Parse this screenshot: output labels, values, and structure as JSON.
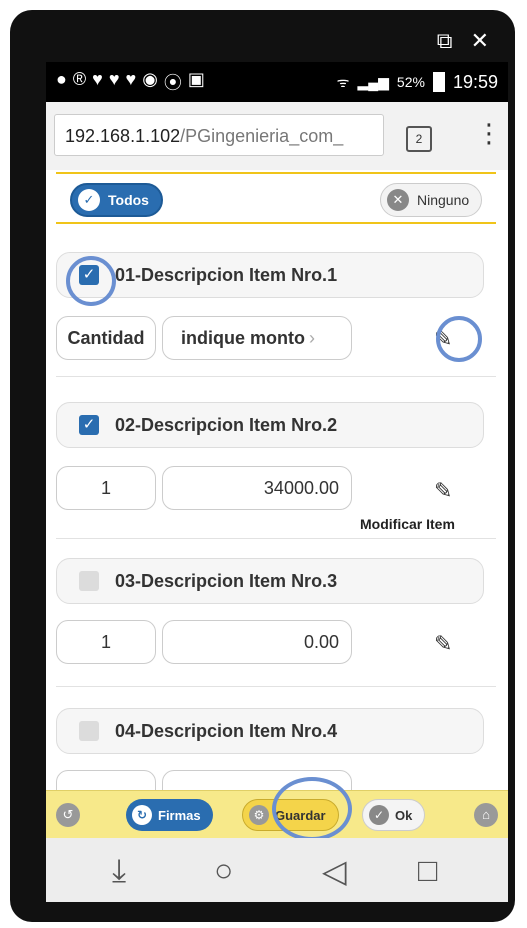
{
  "window_controls": {
    "expand_glyph": "⧉",
    "close_glyph": "✕"
  },
  "status_bar": {
    "notif_icons": [
      "●",
      "®",
      "♥",
      "♥",
      "♥",
      "◉",
      "⦿",
      "▣"
    ],
    "wifi": "ᯤ",
    "signal": "▂▄▆",
    "battery": "52%",
    "time": "19:59"
  },
  "browser": {
    "url_host": "192.168.1.102",
    "url_path": "/PGingenieria_com_",
    "tab_count": "2",
    "menu": "⋮"
  },
  "filters": {
    "all_label": "Todos",
    "none_label": "Ninguno",
    "all_icon": "✓",
    "none_icon": "✕"
  },
  "items": [
    {
      "title": "01-Descripcion Item Nro.1",
      "checked": true,
      "qty": "Cantidad",
      "value": "indique monto",
      "value_suffix": "›"
    },
    {
      "title": "02-Descripcion Item Nro.2",
      "checked": true,
      "qty": "1",
      "value": "34000.00",
      "edit_label": "Modificar Item"
    },
    {
      "title": "03-Descripcion Item Nro.3",
      "checked": false,
      "qty": "1",
      "value": "0.00"
    },
    {
      "title": "04-Descripcion Item Nro.4",
      "checked": false
    }
  ],
  "edit_icon": "✎",
  "footer": {
    "back": "↺",
    "firmas": "Firmas",
    "guardar": "Guardar",
    "ok": "Ok",
    "home": "⌂",
    "firmas_icon": "↻",
    "guardar_icon": "⚙",
    "ok_icon": "✓"
  },
  "android_nav": {
    "down": "⤓",
    "home": "○",
    "back": "◁",
    "recent": "□"
  }
}
